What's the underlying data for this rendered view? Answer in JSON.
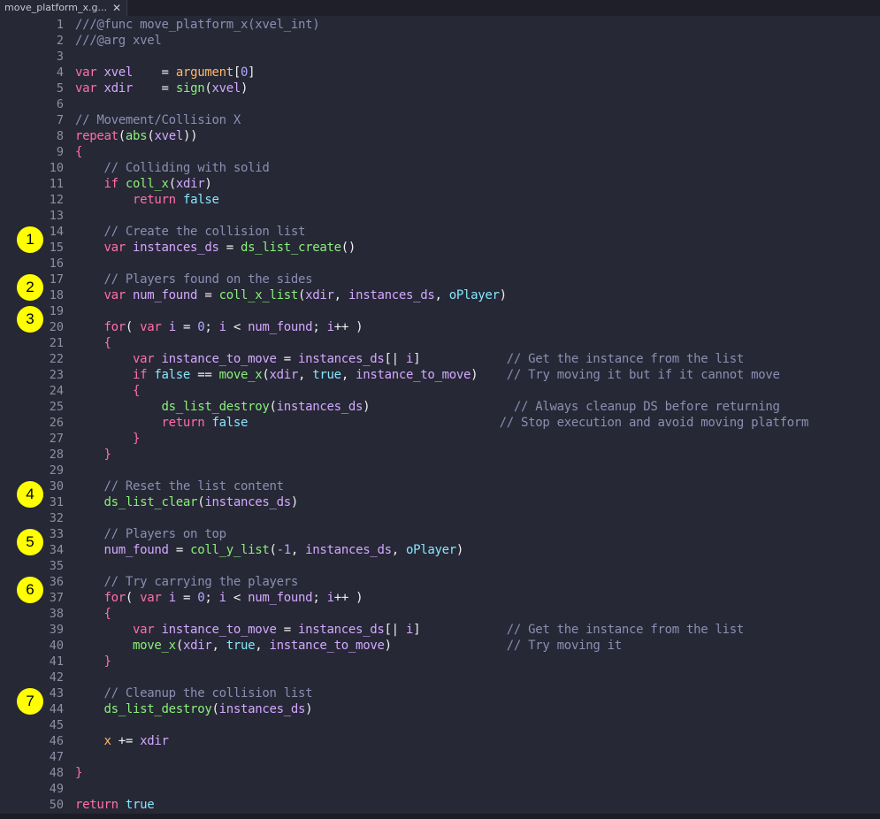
{
  "tab": {
    "title": "move_platform_x.g...",
    "close": "✕"
  },
  "markers": [
    {
      "label": "1",
      "line": 15
    },
    {
      "label": "2",
      "line": 18
    },
    {
      "label": "3",
      "line": 20
    },
    {
      "label": "4",
      "line": 31
    },
    {
      "label": "5",
      "line": 34
    },
    {
      "label": "6",
      "line": 37
    },
    {
      "label": "7",
      "line": 44
    }
  ],
  "lines": [
    [
      [
        "c",
        "///@func move_platform_x(xvel_int)"
      ]
    ],
    [
      [
        "c",
        "///@arg xvel"
      ]
    ],
    [],
    [
      [
        "k",
        "var "
      ],
      [
        "v",
        "xvel"
      ],
      [
        "p",
        "    = "
      ],
      [
        "o",
        "argument"
      ],
      [
        "p",
        "["
      ],
      [
        "n",
        "0"
      ],
      [
        "p",
        "]"
      ]
    ],
    [
      [
        "k",
        "var "
      ],
      [
        "v",
        "xdir"
      ],
      [
        "p",
        "    = "
      ],
      [
        "f",
        "sign"
      ],
      [
        "p",
        "("
      ],
      [
        "v",
        "xvel"
      ],
      [
        "p",
        ")"
      ]
    ],
    [],
    [
      [
        "c",
        "// Movement/Collision X"
      ]
    ],
    [
      [
        "k",
        "repeat"
      ],
      [
        "p",
        "("
      ],
      [
        "f",
        "abs"
      ],
      [
        "p",
        "("
      ],
      [
        "v",
        "xvel"
      ],
      [
        "p",
        "))"
      ]
    ],
    [
      [
        "k",
        "{"
      ]
    ],
    [
      [
        "p",
        "    "
      ],
      [
        "c",
        "// Colliding with solid"
      ]
    ],
    [
      [
        "p",
        "    "
      ],
      [
        "k",
        "if "
      ],
      [
        "f",
        "coll_x"
      ],
      [
        "p",
        "("
      ],
      [
        "v",
        "xdir"
      ],
      [
        "p",
        ")"
      ]
    ],
    [
      [
        "p",
        "        "
      ],
      [
        "k",
        "return "
      ],
      [
        "b",
        "false"
      ]
    ],
    [],
    [
      [
        "p",
        "    "
      ],
      [
        "c",
        "// Create the collision list"
      ]
    ],
    [
      [
        "p",
        "    "
      ],
      [
        "k",
        "var "
      ],
      [
        "v",
        "instances_ds"
      ],
      [
        "p",
        " = "
      ],
      [
        "f",
        "ds_list_create"
      ],
      [
        "p",
        "()"
      ]
    ],
    [],
    [
      [
        "p",
        "    "
      ],
      [
        "c",
        "// Players found on the sides"
      ]
    ],
    [
      [
        "p",
        "    "
      ],
      [
        "k",
        "var "
      ],
      [
        "v",
        "num_found"
      ],
      [
        "p",
        " = "
      ],
      [
        "f",
        "coll_x_list"
      ],
      [
        "p",
        "("
      ],
      [
        "v",
        "xdir"
      ],
      [
        "p",
        ", "
      ],
      [
        "v",
        "instances_ds"
      ],
      [
        "p",
        ", "
      ],
      [
        "b",
        "oPlayer"
      ],
      [
        "p",
        ")"
      ]
    ],
    [],
    [
      [
        "p",
        "    "
      ],
      [
        "k",
        "for"
      ],
      [
        "p",
        "( "
      ],
      [
        "k",
        "var "
      ],
      [
        "v",
        "i"
      ],
      [
        "p",
        " = "
      ],
      [
        "n",
        "0"
      ],
      [
        "p",
        "; "
      ],
      [
        "v",
        "i"
      ],
      [
        "p",
        " < "
      ],
      [
        "v",
        "num_found"
      ],
      [
        "p",
        "; "
      ],
      [
        "v",
        "i"
      ],
      [
        "p",
        "++ )"
      ]
    ],
    [
      [
        "p",
        "    "
      ],
      [
        "k",
        "{"
      ]
    ],
    [
      [
        "p",
        "        "
      ],
      [
        "k",
        "var "
      ],
      [
        "v",
        "instance_to_move"
      ],
      [
        "p",
        " = "
      ],
      [
        "v",
        "instances_ds"
      ],
      [
        "p",
        "[| "
      ],
      [
        "v",
        "i"
      ],
      [
        "p",
        "]            "
      ],
      [
        "c",
        "// Get the instance from the list"
      ]
    ],
    [
      [
        "p",
        "        "
      ],
      [
        "k",
        "if "
      ],
      [
        "b",
        "false"
      ],
      [
        "p",
        " == "
      ],
      [
        "f",
        "move_x"
      ],
      [
        "p",
        "("
      ],
      [
        "v",
        "xdir"
      ],
      [
        "p",
        ", "
      ],
      [
        "b",
        "true"
      ],
      [
        "p",
        ", "
      ],
      [
        "v",
        "instance_to_move"
      ],
      [
        "p",
        ")    "
      ],
      [
        "c",
        "// Try moving it but if it cannot move"
      ]
    ],
    [
      [
        "p",
        "        "
      ],
      [
        "k",
        "{"
      ]
    ],
    [
      [
        "p",
        "            "
      ],
      [
        "f",
        "ds_list_destroy"
      ],
      [
        "p",
        "("
      ],
      [
        "v",
        "instances_ds"
      ],
      [
        "p",
        ")                    "
      ],
      [
        "c",
        "// Always cleanup DS before returning"
      ]
    ],
    [
      [
        "p",
        "            "
      ],
      [
        "k",
        "return "
      ],
      [
        "b",
        "false"
      ],
      [
        "p",
        "                                   "
      ],
      [
        "c",
        "// Stop execution and avoid moving platform"
      ]
    ],
    [
      [
        "p",
        "        "
      ],
      [
        "k",
        "}"
      ]
    ],
    [
      [
        "p",
        "    "
      ],
      [
        "k",
        "}"
      ]
    ],
    [],
    [
      [
        "p",
        "    "
      ],
      [
        "c",
        "// Reset the list content"
      ]
    ],
    [
      [
        "p",
        "    "
      ],
      [
        "f",
        "ds_list_clear"
      ],
      [
        "p",
        "("
      ],
      [
        "v",
        "instances_ds"
      ],
      [
        "p",
        ")"
      ]
    ],
    [],
    [
      [
        "p",
        "    "
      ],
      [
        "c",
        "// Players on top"
      ]
    ],
    [
      [
        "p",
        "    "
      ],
      [
        "v",
        "num_found"
      ],
      [
        "p",
        " = "
      ],
      [
        "f",
        "coll_y_list"
      ],
      [
        "p",
        "("
      ],
      [
        "n",
        "-1"
      ],
      [
        "p",
        ", "
      ],
      [
        "v",
        "instances_ds"
      ],
      [
        "p",
        ", "
      ],
      [
        "b",
        "oPlayer"
      ],
      [
        "p",
        ")"
      ]
    ],
    [],
    [
      [
        "p",
        "    "
      ],
      [
        "c",
        "// Try carrying the players"
      ]
    ],
    [
      [
        "p",
        "    "
      ],
      [
        "k",
        "for"
      ],
      [
        "p",
        "( "
      ],
      [
        "k",
        "var "
      ],
      [
        "v",
        "i"
      ],
      [
        "p",
        " = "
      ],
      [
        "n",
        "0"
      ],
      [
        "p",
        "; "
      ],
      [
        "v",
        "i"
      ],
      [
        "p",
        " < "
      ],
      [
        "v",
        "num_found"
      ],
      [
        "p",
        "; "
      ],
      [
        "v",
        "i"
      ],
      [
        "p",
        "++ )"
      ]
    ],
    [
      [
        "p",
        "    "
      ],
      [
        "k",
        "{"
      ]
    ],
    [
      [
        "p",
        "        "
      ],
      [
        "k",
        "var "
      ],
      [
        "v",
        "instance_to_move"
      ],
      [
        "p",
        " = "
      ],
      [
        "v",
        "instances_ds"
      ],
      [
        "p",
        "[| "
      ],
      [
        "v",
        "i"
      ],
      [
        "p",
        "]            "
      ],
      [
        "c",
        "// Get the instance from the list"
      ]
    ],
    [
      [
        "p",
        "        "
      ],
      [
        "f",
        "move_x"
      ],
      [
        "p",
        "("
      ],
      [
        "v",
        "xdir"
      ],
      [
        "p",
        ", "
      ],
      [
        "b",
        "true"
      ],
      [
        "p",
        ", "
      ],
      [
        "v",
        "instance_to_move"
      ],
      [
        "p",
        ")                "
      ],
      [
        "c",
        "// Try moving it"
      ]
    ],
    [
      [
        "p",
        "    "
      ],
      [
        "k",
        "}"
      ]
    ],
    [],
    [
      [
        "p",
        "    "
      ],
      [
        "c",
        "// Cleanup the collision list"
      ]
    ],
    [
      [
        "p",
        "    "
      ],
      [
        "f",
        "ds_list_destroy"
      ],
      [
        "p",
        "("
      ],
      [
        "v",
        "instances_ds"
      ],
      [
        "p",
        ")"
      ]
    ],
    [],
    [
      [
        "p",
        "    "
      ],
      [
        "o",
        "x"
      ],
      [
        "p",
        " += "
      ],
      [
        "v",
        "xdir"
      ]
    ],
    [],
    [
      [
        "k",
        "}"
      ]
    ],
    [],
    [
      [
        "k",
        "return "
      ],
      [
        "b",
        "true"
      ]
    ]
  ]
}
